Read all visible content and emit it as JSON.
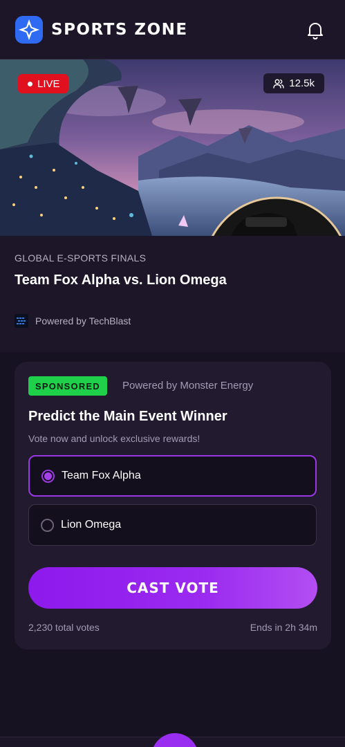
{
  "header": {
    "brand": "SPORTS ZONE",
    "icons": [
      "app-logo-icon",
      "bell-icon"
    ]
  },
  "hero": {
    "live_label": "LIVE",
    "viewer_count": "12.5k",
    "icons": [
      "users-icon"
    ]
  },
  "event": {
    "subtitle": "GLOBAL E-SPORTS FINALS",
    "title": "Team Fox Alpha vs. Lion Omega",
    "powered_by": "Powered by TechBlast"
  },
  "poll": {
    "badge": "SPONSORED",
    "sponsor": "Powered by Monster Energy",
    "question": "Predict the Main Event Winner",
    "subtitle": "Vote now and unlock exclusive rewards!",
    "options": [
      {
        "label": "Team Fox Alpha",
        "selected": true
      },
      {
        "label": "Lion Omega",
        "selected": false
      }
    ],
    "button_label": "CAST VOTE",
    "total_votes": "2,230 total votes",
    "ends_in": "Ends in 2h 34m"
  },
  "colors": {
    "background": "#171221",
    "card": "#221b30",
    "accent": "#9b38e4",
    "live": "#e0101e",
    "sponsored": "#1fd14a"
  }
}
